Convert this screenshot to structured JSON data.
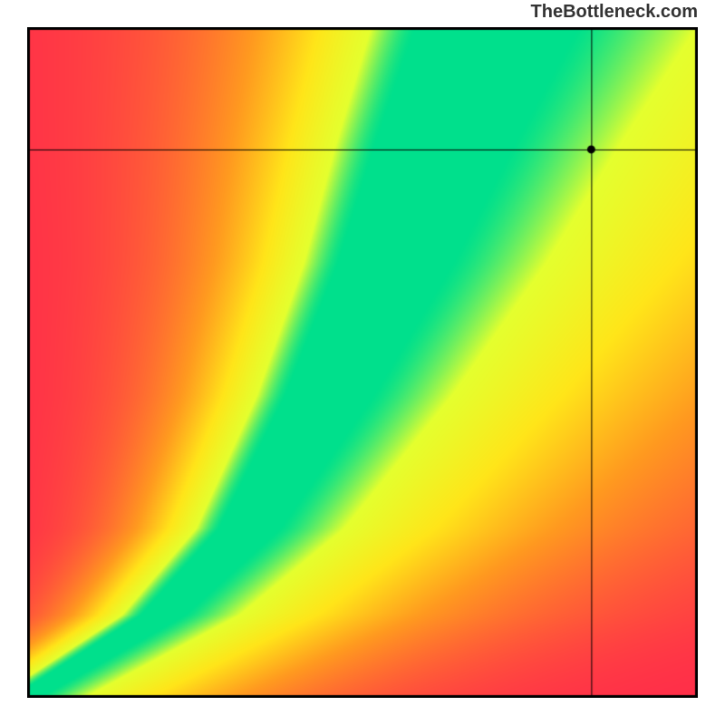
{
  "watermark": "TheBottleneck.com",
  "chart_data": {
    "type": "heatmap",
    "title": "",
    "xlabel": "",
    "ylabel": "",
    "xlim": [
      0,
      100
    ],
    "ylim": [
      0,
      100
    ],
    "crosshair": {
      "x": 84.5,
      "y": 82.0
    },
    "marker_point": {
      "x": 84.5,
      "y": 82.0
    },
    "color_stops": [
      {
        "t": 0.0,
        "color": "#ff2b4a"
      },
      {
        "t": 0.45,
        "color": "#ff9a1f"
      },
      {
        "t": 0.7,
        "color": "#ffe519"
      },
      {
        "t": 0.9,
        "color": "#e4ff2e"
      },
      {
        "t": 1.0,
        "color": "#00e08c"
      }
    ],
    "ridge": [
      {
        "x": 0,
        "y": 0
      },
      {
        "x": 20,
        "y": 12
      },
      {
        "x": 33,
        "y": 25
      },
      {
        "x": 45,
        "y": 45
      },
      {
        "x": 55,
        "y": 65
      },
      {
        "x": 62,
        "y": 82
      },
      {
        "x": 70,
        "y": 100
      }
    ],
    "ridge_width_top": 0.12,
    "ridge_width_bottom": 0.02,
    "upper_right_floor": 0.62,
    "description": "Smooth 2D field: highest (green) along a curved diagonal ridge from lower-left toward upper-center; falls off through yellow, orange to red toward lower-right and upper-left; the upper-right quadrant plateaus around orange. Crosshair drawn at the marker point with a small black dot."
  }
}
